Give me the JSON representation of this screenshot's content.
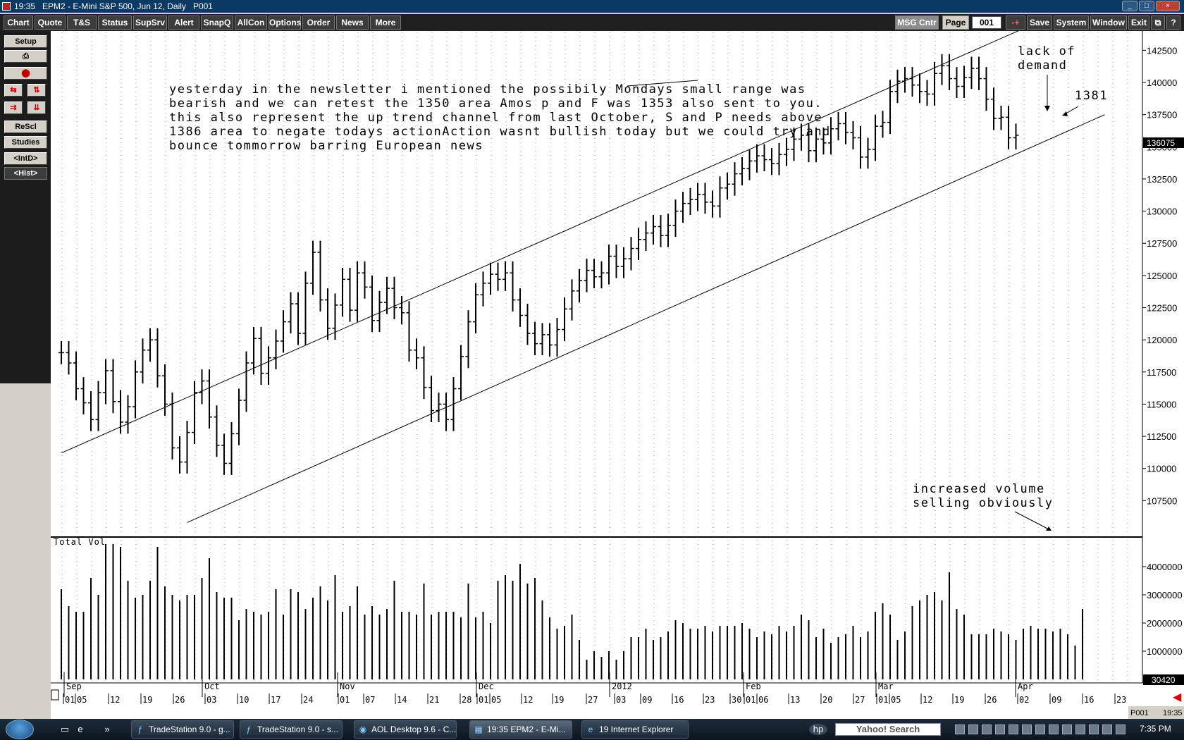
{
  "window": {
    "time": "19:35",
    "title": "EPM2 - E-Mini S&P 500, Jun 12, Daily",
    "page_id": "P001"
  },
  "toolbar": {
    "left_buttons": [
      "Chart",
      "Quote",
      "T&S",
      "Status",
      "SupSrv",
      "Alert",
      "SnapQ",
      "AllCon",
      "Options",
      "Order",
      "News",
      "More"
    ],
    "msg_center": "MSG Cntr",
    "page_label": "Page",
    "page_value": "001",
    "page_stepper": "-+",
    "right_buttons": [
      "Save",
      "System",
      "Window",
      "Exit"
    ],
    "restore_icon": "restore-window-icon",
    "help": "?"
  },
  "sidebar": {
    "setup": "Setup",
    "print_icon": "print-icon",
    "red_icon": "record-icon",
    "rescl": "ReScl",
    "studies": "Studies",
    "intd": "<IntD>",
    "hist": "<Hist>"
  },
  "chart_data": {
    "type": "bar",
    "symbol": "EPM2",
    "description": "OHLC daily price bars with total volume sub-panel",
    "last_price": "136075",
    "price_axis": {
      "ylim": [
        105000,
        144000
      ],
      "ticks": [
        "142500",
        "140000",
        "137500",
        "135000",
        "132500",
        "130000",
        "127500",
        "125000",
        "122500",
        "120000",
        "117500",
        "115000",
        "112500",
        "110000",
        "107500"
      ]
    },
    "volume_panel": {
      "label": "Total Vol",
      "ticks": [
        "4000000",
        "3000000",
        "2000000",
        "1000000"
      ],
      "last_value": "30420",
      "ylim": [
        0,
        5000000
      ]
    },
    "months": [
      "Sep",
      "Oct",
      "Nov",
      "Dec",
      "2012",
      "Feb",
      "Mar",
      "Apr"
    ],
    "days": [
      "01",
      "05",
      "12",
      "19",
      "26",
      "03",
      "10",
      "17",
      "24",
      "01",
      "07",
      "14",
      "21",
      "28",
      "01",
      "05",
      "12",
      "19",
      "27",
      "03",
      "09",
      "16",
      "23",
      "30",
      "01",
      "06",
      "13",
      "20",
      "27",
      "01",
      "05",
      "12",
      "19",
      "26",
      "02",
      "09",
      "16",
      "23"
    ],
    "channel_lines": [
      {
        "name": "upper",
        "points": [
          [
            0,
            111200
          ],
          [
            134,
            145200
          ]
        ]
      },
      {
        "name": "lower",
        "points": [
          [
            17,
            105800
          ],
          [
            141,
            137500
          ]
        ]
      }
    ],
    "close": [
      119000,
      118200,
      116200,
      115100,
      113800,
      115900,
      117600,
      115200,
      113600,
      114800,
      117500,
      119200,
      120000,
      117200,
      115000,
      111600,
      110500,
      112800,
      115900,
      116800,
      114000,
      111800,
      110400,
      112700,
      115300,
      118200,
      120100,
      117400,
      118600,
      119900,
      121400,
      122800,
      120500,
      124400,
      126800,
      123100,
      120900,
      122700,
      124700,
      122300,
      125200,
      124100,
      121500,
      122900,
      124000,
      122500,
      122100,
      119200,
      118600,
      116300,
      114500,
      115000,
      113800,
      116200,
      118700,
      121400,
      123500,
      124400,
      125100,
      124700,
      125200,
      123100,
      121900,
      120500,
      119700,
      120400,
      119600,
      120800,
      122400,
      123800,
      124600,
      125400,
      124900,
      125200,
      126500,
      125700,
      126300,
      127100,
      127800,
      128300,
      128800,
      128100,
      128900,
      130000,
      130600,
      130900,
      131300,
      130700,
      130400,
      131800,
      132100,
      132900,
      133300,
      133900,
      134300,
      134000,
      133700,
      134400,
      134800,
      135600,
      135900,
      134700,
      135600,
      135300,
      136400,
      136800,
      136100,
      135700,
      134200,
      134800,
      136600,
      136900,
      139300,
      140100,
      140300,
      139800,
      139300,
      139100,
      140700,
      141300,
      140300,
      139700,
      140400,
      141100,
      140300,
      138700,
      137200,
      137300,
      135700,
      135900
    ],
    "volume": [
      3200000,
      2600000,
      2400000,
      2400000,
      3600000,
      3000000,
      4800000,
      4800000,
      4700000,
      3500000,
      2900000,
      3000000,
      3500000,
      4700000,
      3300000,
      3000000,
      2800000,
      3000000,
      3000000,
      3600000,
      4300000,
      3100000,
      2900000,
      2900000,
      2100000,
      2500000,
      2400000,
      2300000,
      2400000,
      3200000,
      2300000,
      3200000,
      3100000,
      2500000,
      2900000,
      3300000,
      2800000,
      3700000,
      2400000,
      2600000,
      3300000,
      2300000,
      2600000,
      2300000,
      2500000,
      3500000,
      2400000,
      2400000,
      2300000,
      3400000,
      2300000,
      2400000,
      2400000,
      2400000,
      2200000,
      3400000,
      2200000,
      2400000,
      2000000,
      3500000,
      3700000,
      3500000,
      4100000,
      3400000,
      3600000,
      2800000,
      2200000,
      1800000,
      1900000,
      2300000,
      1400000,
      700000,
      1000000,
      800000,
      1000000,
      700000,
      1000000,
      1500000,
      1500000,
      1800000,
      1400000,
      1500000,
      1700000,
      2100000,
      2000000,
      1800000,
      1800000,
      1900000,
      1700000,
      1900000,
      1900000,
      1900000,
      2000000,
      1800000,
      1500000,
      1700000,
      1600000,
      1900000,
      1700000,
      1900000,
      2300000,
      2100000,
      1500000,
      1800000,
      1300000,
      1500000,
      1600000,
      1900000,
      1500000,
      1700000,
      2400000,
      2700000,
      2300000,
      1400000,
      1700000,
      2600000,
      2800000,
      3000000,
      3100000,
      2800000,
      3800000,
      2500000,
      2300000,
      1600000,
      1600000,
      1600000,
      1800000,
      1700000,
      1600000,
      1400000,
      1800000,
      1900000,
      1800000,
      1800000,
      1700000,
      1800000,
      1600000,
      1200000,
      2500000
    ],
    "annotations": [
      {
        "name": "note",
        "lines": [
          "yesterday in the newsletter i mentioned the possibily Mondays small range was",
          "bearish and we can retest the 1350 area Amos p and F was 1353 also sent to you.",
          "this also represent the up trend channel from last October, S and P needs above",
          "1386 area to negate todays actionAction wasnt bullish today but we could try and",
          "bounce tommorrow barring European news"
        ]
      },
      {
        "name": "lack-of-demand",
        "lines": [
          "lack of",
          "demand"
        ]
      },
      {
        "name": "level-1381",
        "lines": [
          "1381"
        ]
      },
      {
        "name": "increased-volume",
        "lines": [
          "increased volume",
          "selling obviously"
        ]
      }
    ]
  },
  "status": {
    "page": "P001",
    "time": "19:35"
  },
  "taskbar": {
    "tasks": [
      {
        "label": "TradeStation 9.0 - g...",
        "icon": "tradestation-icon"
      },
      {
        "label": "TradeStation 9.0 - s...",
        "icon": "tradestation-icon"
      },
      {
        "label": "AOL Desktop 9.6 - C...",
        "icon": "aol-icon"
      },
      {
        "label": "19:35 EPM2 - E-Mi...",
        "icon": "chart-icon"
      },
      {
        "label": "19 Internet Explorer",
        "icon": "ie-icon"
      }
    ],
    "search": "Yahoo! Search",
    "clock": "7:35 PM"
  }
}
